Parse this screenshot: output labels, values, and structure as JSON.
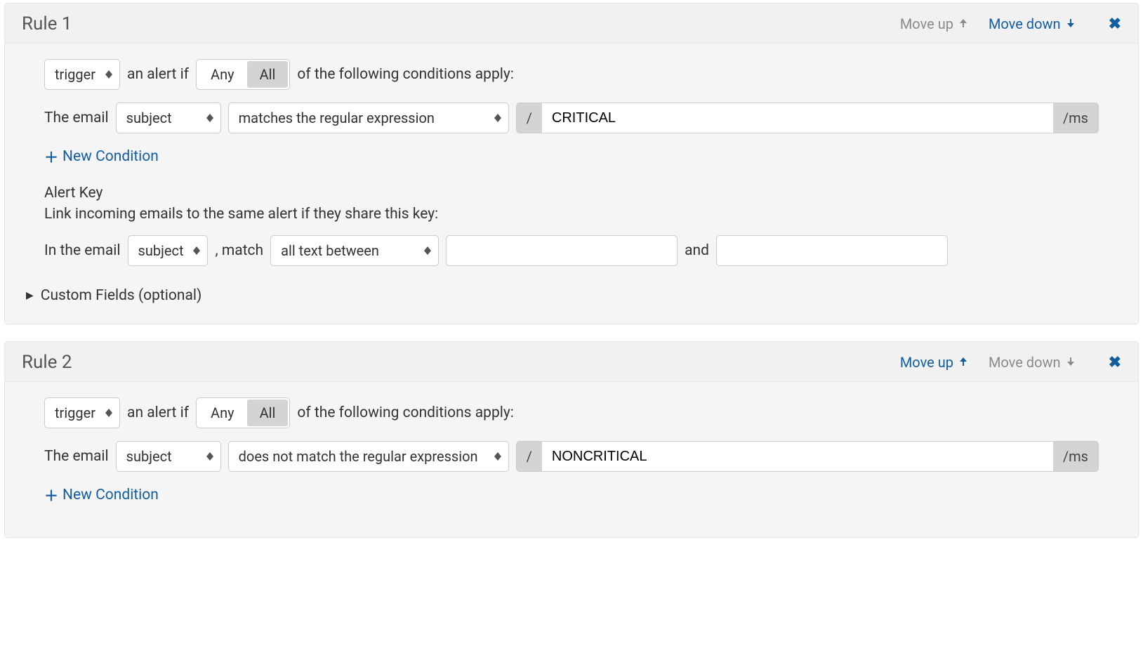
{
  "rules": [
    {
      "title": "Rule 1",
      "move_up_label": "Move up",
      "move_up_enabled": false,
      "move_down_label": "Move down",
      "move_down_enabled": true,
      "trigger_select": "trigger",
      "text_an_alert_if": "an alert if",
      "any_label": "Any",
      "all_label": "All",
      "text_following": "of the following conditions apply:",
      "cond_prefix": "The email",
      "cond_field": "subject",
      "cond_operator": "matches the regular expression",
      "regex_open": "/",
      "regex_value": "CRITICAL",
      "regex_close": "/ms",
      "new_condition_label": "New Condition",
      "alert_key_heading": "Alert Key",
      "alert_key_desc": "Link incoming emails to the same alert if they share this key:",
      "ak_prefix": "In the email",
      "ak_field": "subject",
      "ak_match_label": ", match",
      "ak_operator": "all text between",
      "ak_value1": "",
      "ak_and": "and",
      "ak_value2": "",
      "custom_fields_label": "Custom Fields (optional)"
    },
    {
      "title": "Rule 2",
      "move_up_label": "Move up",
      "move_up_enabled": true,
      "move_down_label": "Move down",
      "move_down_enabled": false,
      "trigger_select": "trigger",
      "text_an_alert_if": "an alert if",
      "any_label": "Any",
      "all_label": "All",
      "text_following": "of the following conditions apply:",
      "cond_prefix": "The email",
      "cond_field": "subject",
      "cond_operator": "does not match the regular expression",
      "regex_open": "/",
      "regex_value": "NONCRITICAL",
      "regex_close": "/ms",
      "new_condition_label": "New Condition"
    }
  ]
}
